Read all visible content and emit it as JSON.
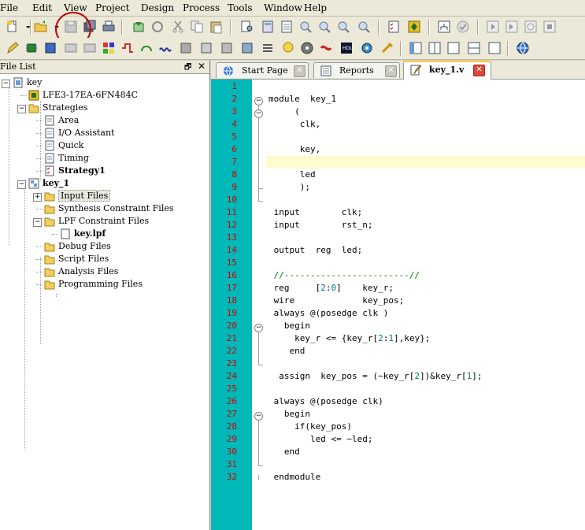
{
  "menu": [
    "File",
    "Edit",
    "View",
    "Project",
    "Design",
    "Process",
    "Tools",
    "Window",
    "Help"
  ],
  "file_list": {
    "title": "File List",
    "tree": [
      {
        "label": "key",
        "level": 0,
        "bold": false,
        "icon": "project-icon",
        "expander": "minus"
      },
      {
        "label": "LFE3-17EA-6FN484C",
        "level": 1,
        "bold": false,
        "icon": "device-icon",
        "expander": ""
      },
      {
        "label": "Strategies",
        "level": 1,
        "bold": false,
        "icon": "folder-open-icon",
        "expander": "minus"
      },
      {
        "label": "Area",
        "level": 2,
        "bold": false,
        "icon": "strategy-icon",
        "expander": ""
      },
      {
        "label": "I/O Assistant",
        "level": 2,
        "bold": false,
        "icon": "strategy-icon",
        "expander": ""
      },
      {
        "label": "Quick",
        "level": 2,
        "bold": false,
        "icon": "strategy-icon",
        "expander": ""
      },
      {
        "label": "Timing",
        "level": 2,
        "bold": false,
        "icon": "strategy-icon",
        "expander": ""
      },
      {
        "label": "Strategy1",
        "level": 2,
        "bold": true,
        "icon": "strategy-active-icon",
        "expander": ""
      },
      {
        "label": "key_1",
        "level": 1,
        "bold": true,
        "icon": "implementation-icon",
        "expander": "minus"
      },
      {
        "label": "Input Files",
        "level": 2,
        "bold": false,
        "icon": "folder-icon",
        "expander": "plus",
        "selected": true
      },
      {
        "label": "Synthesis Constraint Files",
        "level": 2,
        "bold": false,
        "icon": "folder-icon",
        "expander": ""
      },
      {
        "label": "LPF Constraint Files",
        "level": 2,
        "bold": false,
        "icon": "folder-open-icon",
        "expander": "minus"
      },
      {
        "label": "key.lpf",
        "level": 3,
        "bold": true,
        "icon": "file-icon",
        "expander": ""
      },
      {
        "label": "Debug Files",
        "level": 2,
        "bold": false,
        "icon": "folder-icon",
        "expander": ""
      },
      {
        "label": "Script Files",
        "level": 2,
        "bold": false,
        "icon": "folder-icon",
        "expander": ""
      },
      {
        "label": "Analysis Files",
        "level": 2,
        "bold": false,
        "icon": "folder-icon",
        "expander": ""
      },
      {
        "label": "Programming Files",
        "level": 2,
        "bold": false,
        "icon": "folder-icon",
        "expander": ""
      }
    ]
  },
  "tabs": [
    {
      "label": "Start Page",
      "icon": "start-page-icon",
      "active": false
    },
    {
      "label": "Reports",
      "icon": "reports-icon",
      "active": false
    },
    {
      "label": "key_1.v",
      "icon": "verilog-file-icon",
      "active": true
    }
  ],
  "editor": {
    "lines": [
      "",
      "module  key_1",
      "     (",
      "      clk,",
      "",
      "      key,",
      "",
      "      led",
      "      );",
      "",
      " input        clk;",
      " input        rst_n;",
      "",
      " output  reg  led;",
      "",
      " //------------------------//",
      " reg     [2:0]    key_r;",
      " wire             key_pos;",
      " always @(posedge clk )",
      "   begin",
      "     key_r <= {key_r[2:1],key};",
      "    end",
      "",
      "  assign  key_pos = (~key_r[2])&key_r[1];",
      "",
      " always @(posedge clk)",
      "   begin",
      "     if(key_pos)",
      "        led <= ~led;",
      "   end",
      "",
      " endmodule"
    ],
    "current_line": 7
  },
  "colors": {
    "gutter": "#00b8b8",
    "line_numbers": "#cc0000",
    "annotation": "#c00000",
    "current_line": "#fffbd0"
  }
}
